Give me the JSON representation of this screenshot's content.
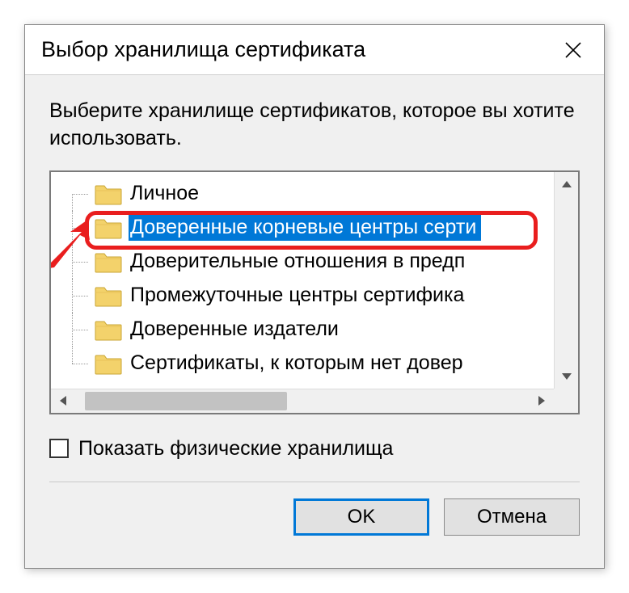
{
  "dialog": {
    "title": "Выбор хранилища сертификата",
    "instruction": "Выберите хранилище сертификатов, которое вы хотите использовать."
  },
  "tree": {
    "items": [
      {
        "label": "Личное",
        "selected": false
      },
      {
        "label": "Доверенные корневые центры серти",
        "selected": true
      },
      {
        "label": "Доверительные отношения в предп",
        "selected": false
      },
      {
        "label": "Промежуточные центры сертифика",
        "selected": false
      },
      {
        "label": "Доверенные издатели",
        "selected": false
      },
      {
        "label": "Сертификаты, к которым нет довер",
        "selected": false
      }
    ]
  },
  "checkbox": {
    "label": "Показать физические хранилища",
    "checked": false
  },
  "buttons": {
    "ok": "OK",
    "cancel": "Отмена"
  }
}
